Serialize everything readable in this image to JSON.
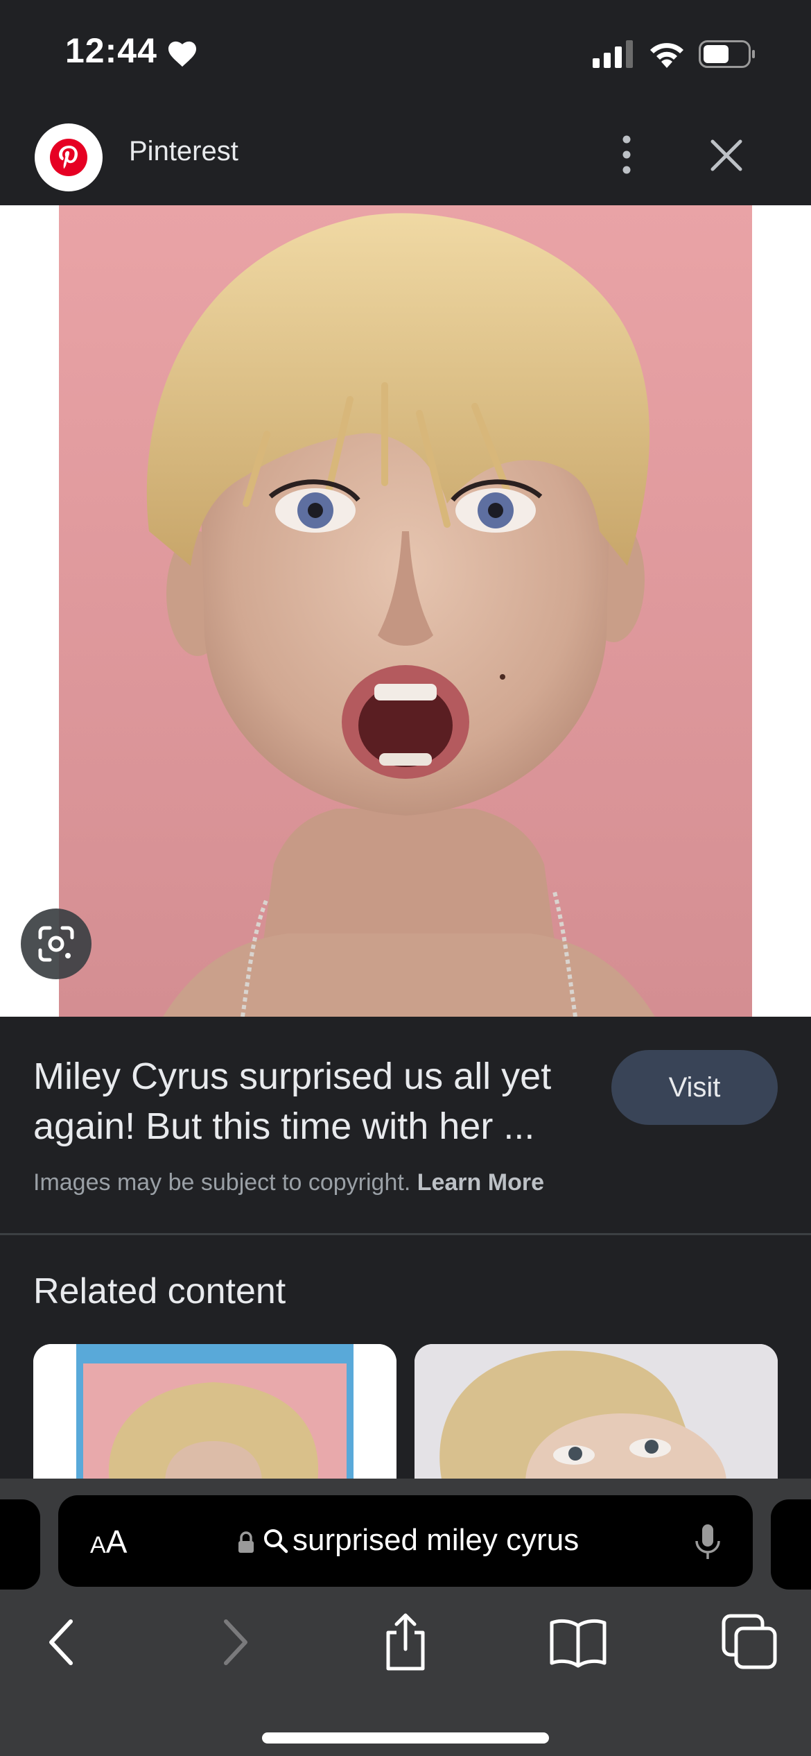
{
  "status_bar": {
    "time": "12:44",
    "heart_icon": "heart-icon",
    "signal_icon": "cellular-signal-icon",
    "wifi_icon": "wifi-icon",
    "battery_icon": "battery-icon"
  },
  "header": {
    "site_name": "Pinterest",
    "logo_icon": "pinterest-logo-icon",
    "more_icon": "more-vertical-icon",
    "close_icon": "close-icon"
  },
  "image": {
    "lens_icon": "google-lens-icon"
  },
  "result": {
    "title": "Miley Cyrus surprised us all yet again! But this time with her ...",
    "visit_label": "Visit",
    "copyright_text": "Images may be subject to copyright.",
    "learn_more_label": "Learn More"
  },
  "related": {
    "title": "Related content"
  },
  "safari": {
    "text_size_label_small": "A",
    "text_size_label_large": "A",
    "query": "surprised miley cyrus",
    "lock_icon": "lock-icon",
    "search_icon": "search-icon",
    "mic_icon": "microphone-icon",
    "toolbar": [
      "back-icon",
      "forward-icon",
      "share-icon",
      "bookmarks-icon",
      "tabs-icon"
    ]
  },
  "colors": {
    "background": "#202124",
    "visit_button": "#394457",
    "photo_backdrop": "#e9a3a6",
    "safari_bar": "#3a3b3d",
    "pinterest_red": "#e60023"
  }
}
